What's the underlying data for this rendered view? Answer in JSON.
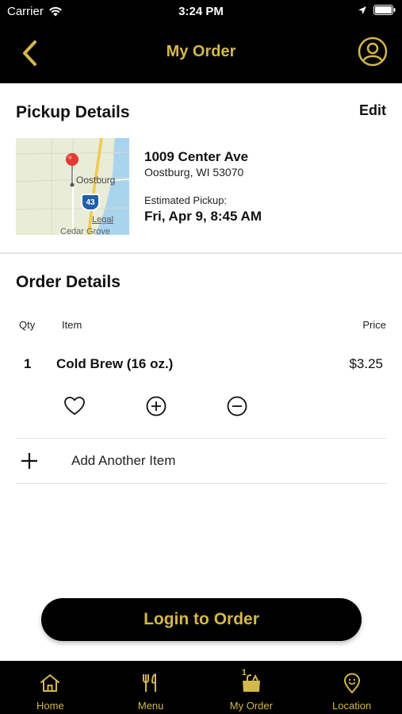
{
  "status_bar": {
    "carrier": "Carrier",
    "time": "3:24 PM"
  },
  "header": {
    "title": "My Order"
  },
  "pickup": {
    "title": "Pickup Details",
    "edit_label": "Edit",
    "map_labels": {
      "town": "Oostburg",
      "shield": "43",
      "legal": "Legal",
      "south_town": "Cedar Grove"
    },
    "address_line1": "1009 Center Ave",
    "address_line2": "Oostburg, WI 53070",
    "estimated_label": "Estimated Pickup:",
    "estimated_value": "Fri, Apr 9, 8:45 AM"
  },
  "order": {
    "title": "Order Details",
    "columns": {
      "qty": "Qty",
      "item": "Item",
      "price": "Price"
    },
    "items": [
      {
        "qty": "1",
        "name": "Cold Brew (16 oz.)",
        "price": "$3.25"
      }
    ],
    "add_item_label": "Add Another Item"
  },
  "cta": {
    "login_label": "Login to Order"
  },
  "tabs": [
    {
      "label": "Home",
      "icon": "home-icon"
    },
    {
      "label": "Menu",
      "icon": "utensils-icon"
    },
    {
      "label": "My Order",
      "icon": "bag-icon",
      "badge": "1"
    },
    {
      "label": "Location",
      "icon": "location-pin-icon"
    }
  ],
  "colors": {
    "accent": "#d4b84a",
    "bar_bg": "#000000"
  }
}
